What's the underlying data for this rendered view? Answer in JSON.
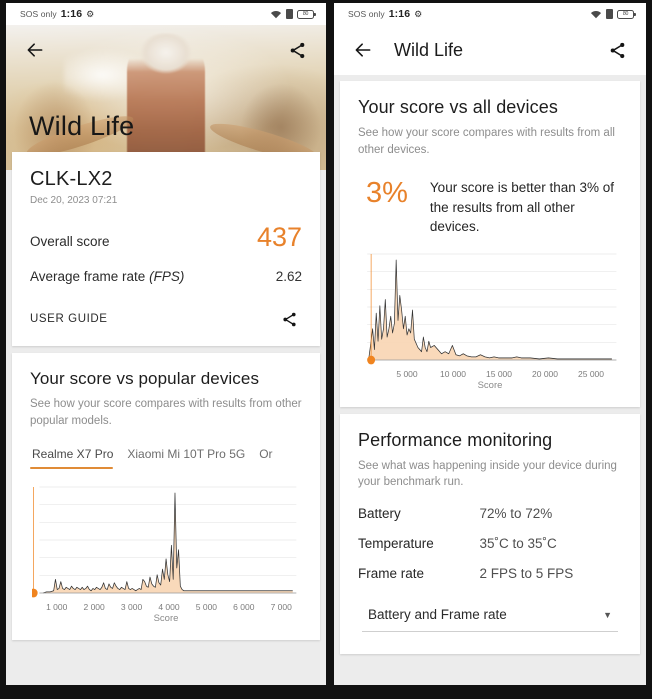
{
  "statusbar": {
    "carrier": "SOS only",
    "time": "1:16",
    "gear_icon": "gear-icon",
    "wifi_icon": "wifi-icon",
    "sim_icon": "sim-icon",
    "battery_icon": "battery-icon",
    "battery_level": "80"
  },
  "left": {
    "back_icon": "back-arrow-icon",
    "share_icon": "share-icon",
    "hero_title": "Wild Life",
    "result": {
      "device_name": "CLK-LX2",
      "date": "Dec 20, 2023 07:21",
      "overall_label": "Overall score",
      "overall_value": "437",
      "fps_label": "Average frame rate",
      "fps_label_italic": "(FPS)",
      "fps_value": "2.62",
      "user_guide": "USER GUIDE",
      "user_guide_share_icon": "share-icon"
    },
    "popular": {
      "title": "Your score vs popular devices",
      "subtitle": "See how your score compares with results from other popular models.",
      "tabs": [
        {
          "label": "Realme X7 Pro",
          "active": true
        },
        {
          "label": "Xiaomi Mi 10T Pro 5G",
          "active": false
        },
        {
          "label": "Or",
          "active": false
        }
      ]
    }
  },
  "right": {
    "back_icon": "back-arrow-icon",
    "share_icon": "share-icon",
    "app_title": "Wild Life",
    "all_devices": {
      "title": "Your score vs all devices",
      "subtitle": "See how your score compares with results from all other devices.",
      "percent": "3%",
      "percent_text": "Your score is better than 3% of the results from all other devices."
    },
    "performance": {
      "title": "Performance monitoring",
      "subtitle": "See what was happening inside your device during your benchmark run.",
      "rows": [
        {
          "key": "Battery",
          "value": "72% to 72%"
        },
        {
          "key": "Temperature",
          "value": "35˚C to 35˚C"
        },
        {
          "key": "Frame rate",
          "value": "2 FPS to 5 FPS"
        }
      ],
      "select_value": "Battery and Frame rate",
      "select_caret_icon": "chevron-down-icon"
    }
  },
  "colors": {
    "accent": "#e8822b",
    "fill": "#f9d6b4",
    "stroke": "#333333",
    "grid": "#e7e7e7",
    "marker": "#f0841f"
  },
  "chart_data": [
    {
      "id": "popular-devices-histogram",
      "type": "area",
      "title": "",
      "xlabel": "Score",
      "ylabel": "",
      "xlim": [
        600,
        7800
      ],
      "ylim": [
        0,
        100
      ],
      "grid": true,
      "marker_x": 437,
      "marker_label": "437",
      "xticks": [
        "1 000",
        "2 000",
        "3 000",
        "4 000",
        "5 000",
        "6 000",
        "7 000"
      ],
      "x": [
        700,
        800,
        900,
        1000,
        1050,
        1100,
        1150,
        1200,
        1250,
        1300,
        1350,
        1400,
        1450,
        1500,
        1550,
        1600,
        1650,
        1700,
        1750,
        1800,
        1850,
        1900,
        1950,
        2000,
        2050,
        2100,
        2150,
        2200,
        2250,
        2300,
        2350,
        2400,
        2450,
        2500,
        2550,
        2600,
        2650,
        2700,
        2750,
        2800,
        2850,
        2900,
        2950,
        3000,
        3050,
        3100,
        3150,
        3200,
        3250,
        3300,
        3350,
        3400,
        3450,
        3500,
        3550,
        3600,
        3650,
        3700,
        3750,
        3800,
        3850,
        3900,
        3950,
        4000,
        4050,
        4100,
        4150,
        4200,
        4250,
        4300,
        4350,
        4400,
        4450,
        4500,
        4550,
        4600,
        4650,
        4700,
        4800,
        5000,
        5400,
        6000,
        6600,
        7200,
        7700
      ],
      "values": [
        0,
        1,
        1,
        2,
        12,
        3,
        4,
        10,
        4,
        3,
        5,
        4,
        3,
        6,
        4,
        3,
        5,
        4,
        3,
        5,
        3,
        4,
        6,
        3,
        2,
        4,
        3,
        5,
        4,
        3,
        5,
        9,
        4,
        3,
        8,
        5,
        4,
        9,
        6,
        4,
        3,
        5,
        4,
        3,
        10,
        4,
        3,
        4,
        3,
        2,
        3,
        4,
        3,
        12,
        10,
        6,
        5,
        14,
        8,
        6,
        5,
        16,
        9,
        7,
        21,
        12,
        30,
        16,
        10,
        42,
        12,
        88,
        22,
        38,
        6,
        3,
        2,
        2,
        2,
        2,
        2,
        2,
        2,
        2,
        2
      ]
    },
    {
      "id": "all-devices-histogram",
      "type": "area",
      "title": "",
      "xlabel": "Score",
      "ylabel": "",
      "xlim": [
        0,
        27500
      ],
      "ylim": [
        0,
        100
      ],
      "grid": true,
      "marker_x": 437,
      "marker_label": "437",
      "xticks": [
        "5 000",
        "10 000",
        "15 000",
        "20 000",
        "25 000"
      ],
      "x": [
        200,
        400,
        600,
        800,
        1000,
        1200,
        1400,
        1600,
        1800,
        2000,
        2200,
        2400,
        2600,
        2800,
        3000,
        3200,
        3400,
        3600,
        3800,
        4000,
        4200,
        4400,
        4600,
        4800,
        5000,
        5200,
        5400,
        5600,
        5800,
        6000,
        6200,
        6400,
        6600,
        6800,
        7000,
        7400,
        7800,
        8200,
        8600,
        9000,
        9400,
        9800,
        10200,
        10600,
        11000,
        11500,
        12000,
        12500,
        13000,
        13500,
        14000,
        14500,
        15000,
        15500,
        16000,
        16500,
        17000,
        17500,
        18000,
        19000,
        20000,
        21000,
        22000,
        23000,
        24000,
        25000,
        26000,
        27000
      ],
      "values": [
        3,
        16,
        30,
        10,
        45,
        18,
        52,
        20,
        30,
        58,
        22,
        30,
        42,
        26,
        35,
        96,
        38,
        62,
        48,
        30,
        42,
        24,
        30,
        26,
        48,
        20,
        16,
        12,
        10,
        8,
        22,
        12,
        8,
        18,
        12,
        14,
        10,
        6,
        8,
        6,
        14,
        5,
        4,
        6,
        4,
        3,
        3,
        5,
        3,
        2,
        3,
        2,
        2,
        2,
        2,
        3,
        2,
        2,
        2,
        1,
        2,
        1,
        1,
        1,
        1,
        1,
        1,
        1
      ]
    }
  ]
}
